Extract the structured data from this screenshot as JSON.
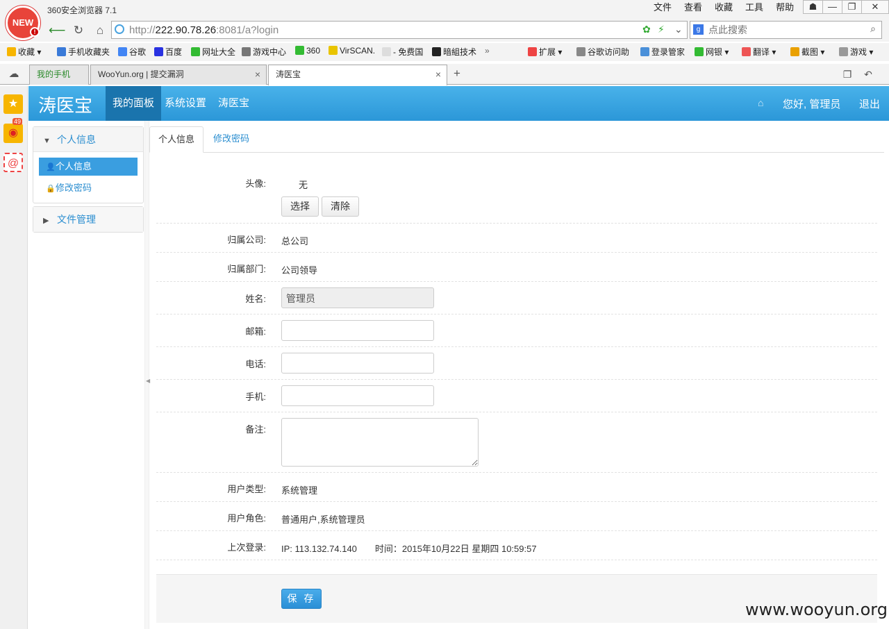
{
  "browser": {
    "logo_text": "NEW",
    "title": "360安全浏览器 7.1",
    "menu": [
      "文件",
      "查看",
      "收藏",
      "工具",
      "帮助"
    ],
    "url_prefix": "http://",
    "url_host": "222.90.78.26",
    "url_rest": ":8081/a?login",
    "search_placeholder": "点此搜索",
    "bookmarks": [
      "收藏",
      "手机收藏夹",
      "谷歌",
      "百度",
      "网址大全",
      "游戏中心",
      "360",
      "VirSCAN.",
      "- 免费国",
      "暗組技术",
      "扩展",
      "谷歌访问助",
      "登录管家",
      "网银",
      "翻译",
      "截图",
      "游戏"
    ],
    "tabs": [
      "我的手机",
      "WooYun.org | 提交漏洞",
      "涛医宝"
    ],
    "weibo_badge": "49"
  },
  "app": {
    "brand": "涛医宝",
    "nav": [
      "我的面板",
      "系统设置",
      "涛医宝"
    ],
    "greeting": "您好, 管理员",
    "logout": "退出"
  },
  "left_panel": {
    "group1_title": "个人信息",
    "items": [
      "个人信息",
      "修改密码"
    ],
    "group2_title": "文件管理"
  },
  "content": {
    "tabs": [
      "个人信息",
      "修改密码"
    ],
    "avatar_label": "头像:",
    "avatar_value": "无",
    "choose_button": "选择",
    "clear_button": "清除",
    "company_label": "归属公司:",
    "company_value": "总公司",
    "dept_label": "归属部门:",
    "dept_value": "公司领导",
    "name_label": "姓名:",
    "name_value": "管理员",
    "email_label": "邮箱:",
    "email_value": "",
    "phone_label": "电话:",
    "phone_value": "",
    "mobile_label": "手机:",
    "mobile_value": "",
    "remarks_label": "备注:",
    "remarks_value": "",
    "usertype_label": "用户类型:",
    "usertype_value": "系统管理",
    "role_label": "用户角色:",
    "role_value": "普通用户,系统管理员",
    "lastlogin_label": "上次登录:",
    "lastlogin_value": "IP: 113.132.74.140　　时间：2015年10月22日 星期四 10:59:57",
    "save_button": "保 存"
  },
  "watermark": "www.wooyun.org"
}
